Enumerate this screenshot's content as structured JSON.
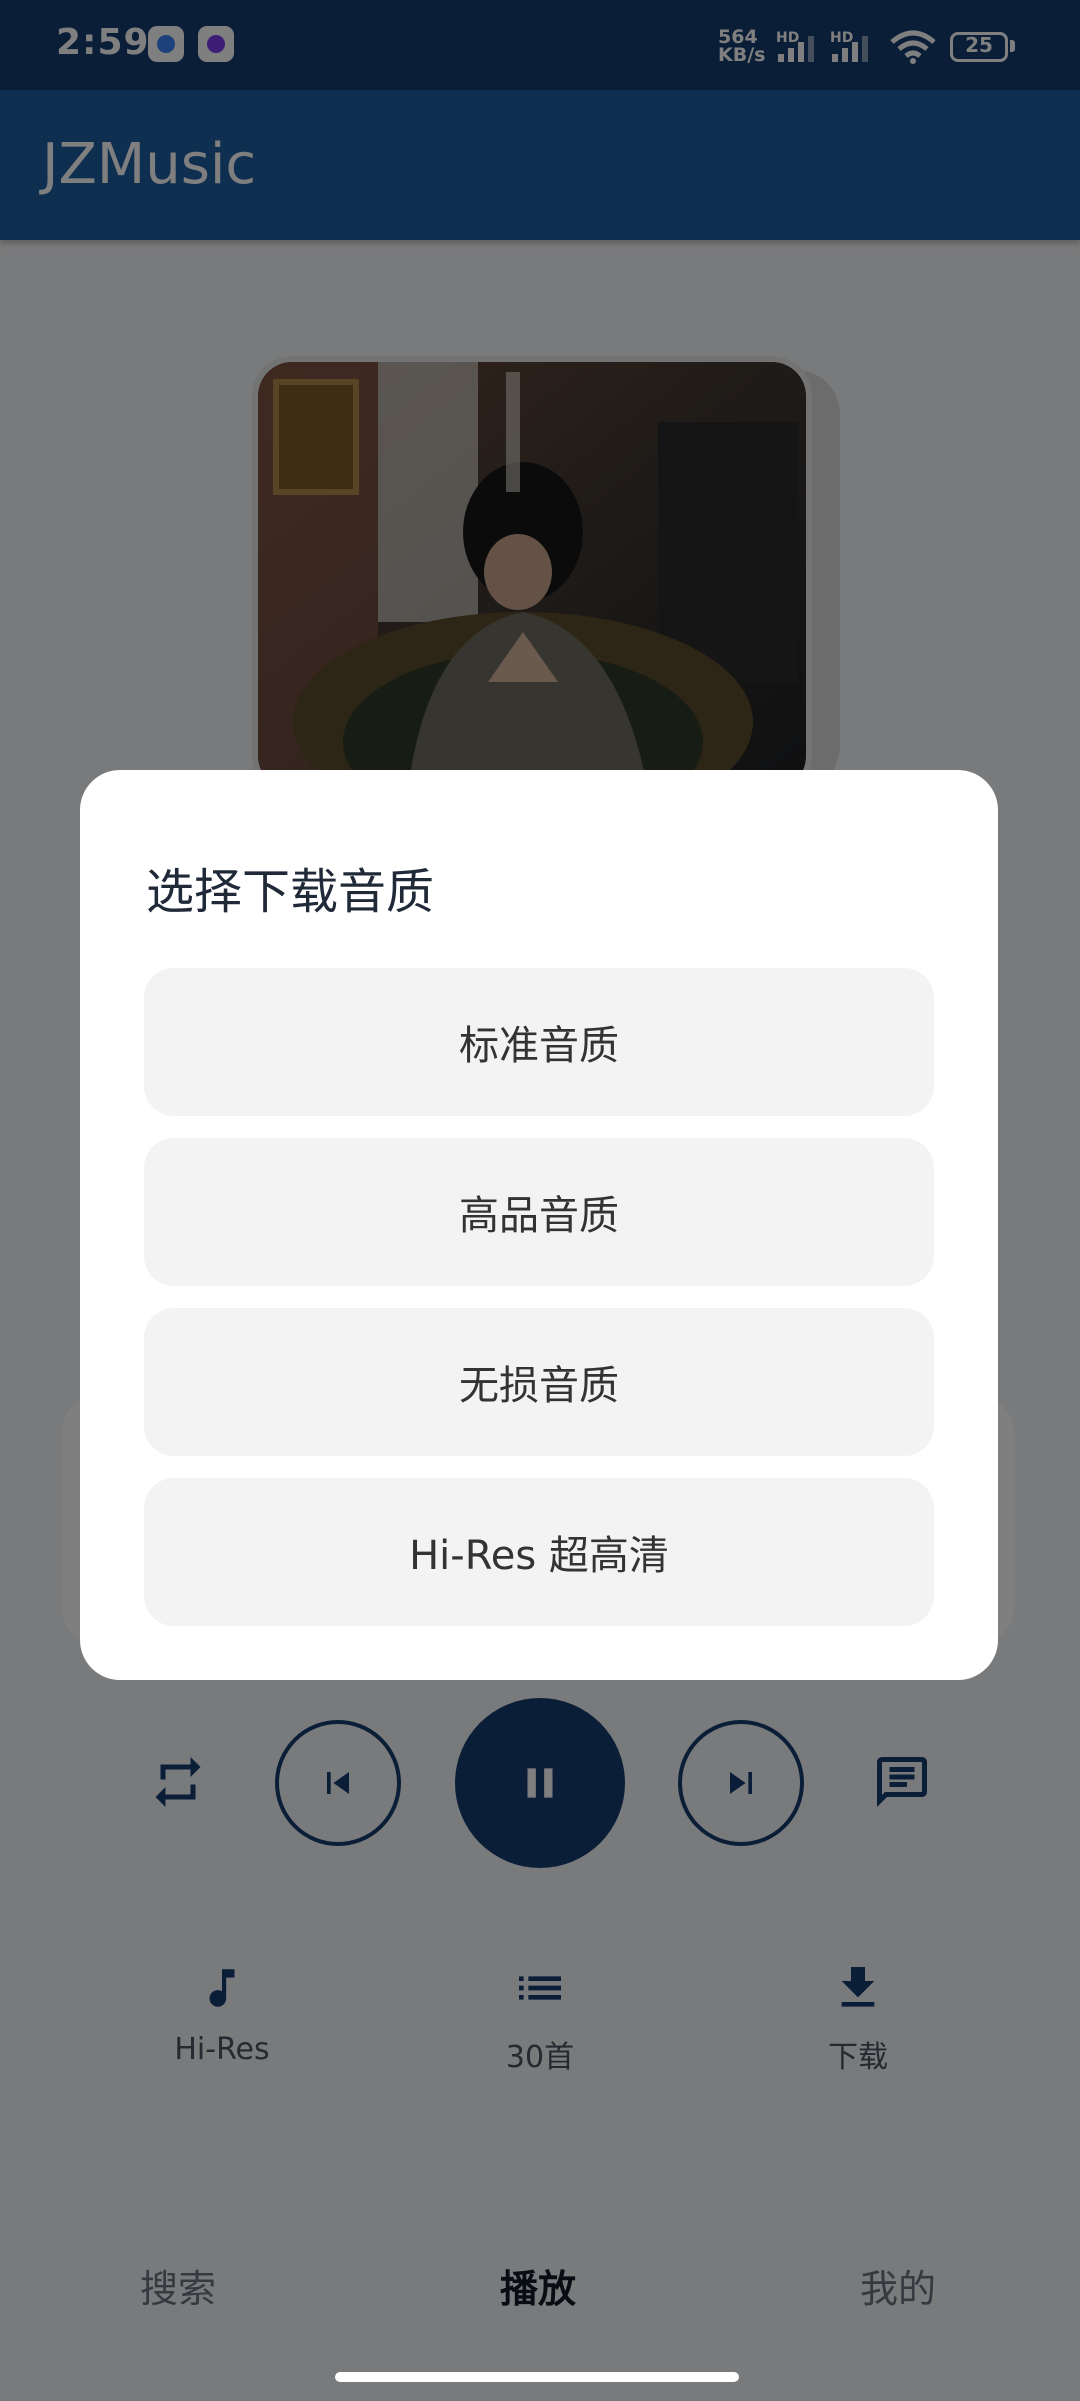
{
  "status_bar": {
    "time": "2:59",
    "net_speed_value": "564",
    "net_speed_unit": "KB/s",
    "hd_label_1": "HD",
    "hd_label_2": "HD",
    "battery": "25"
  },
  "app_bar": {
    "title": "JZMusic"
  },
  "player": {
    "actions": [
      {
        "label": "Hi-Res",
        "icon": "music-note-icon"
      },
      {
        "label": "30首",
        "icon": "playlist-icon"
      },
      {
        "label": "下载",
        "icon": "download-icon"
      }
    ]
  },
  "bottom_nav": {
    "items": [
      {
        "label": "搜索"
      },
      {
        "label": "播放"
      },
      {
        "label": "我的"
      }
    ],
    "active_index": 1
  },
  "dialog": {
    "title": "选择下载音质",
    "options": [
      {
        "label": "标准音质"
      },
      {
        "label": "高品音质"
      },
      {
        "label": "无损音质"
      },
      {
        "label": "Hi-Res 超高清"
      }
    ]
  },
  "colors": {
    "primary_dark": "#163c70",
    "app_bar": "#1e5fa3",
    "dialog_bg": "#ffffff",
    "option_bg": "#f3f3f4"
  }
}
